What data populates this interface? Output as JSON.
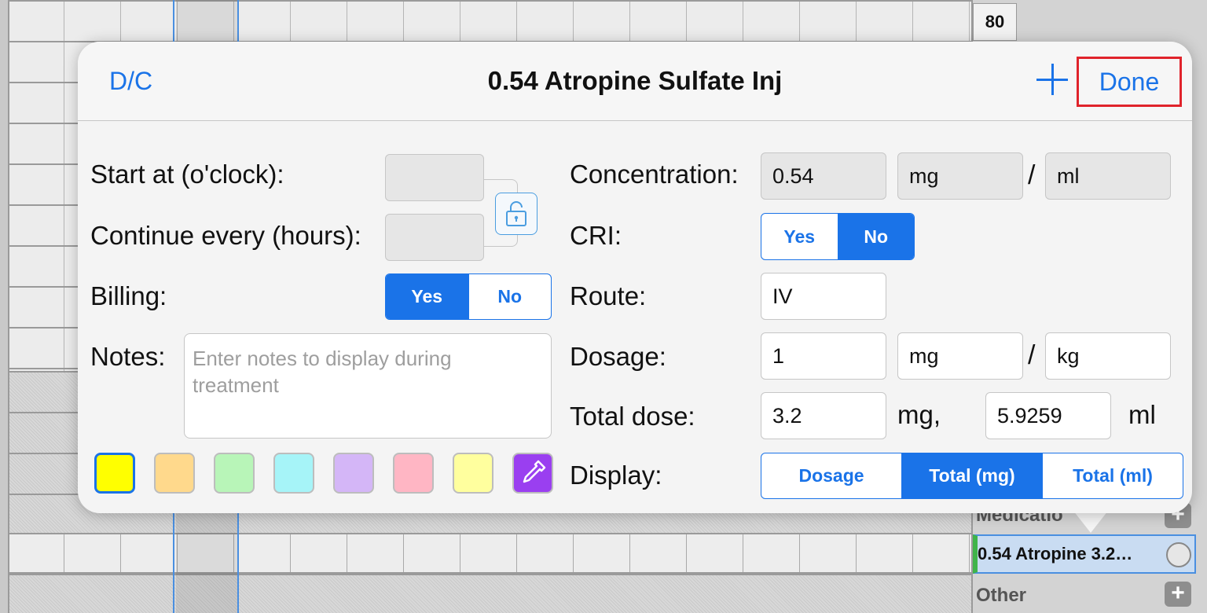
{
  "background": {
    "scale_value": "80",
    "medications_label": "Medicatio",
    "medication_entry": "0.54 Atropine 3.2…",
    "other_label": "Other",
    "add_glyph": "+"
  },
  "dialog": {
    "dc_label": "D/C",
    "title": "0.54 Atropine Sulfate Inj",
    "add_glyph": "+",
    "done_label": "Done"
  },
  "form": {
    "start_at_label": "Start at (o'clock):",
    "start_at_value": "",
    "continue_every_label": "Continue every (hours):",
    "continue_every_value": "",
    "billing_label": "Billing:",
    "billing_options": [
      "Yes",
      "No"
    ],
    "billing_selected": "Yes",
    "notes_label": "Notes:",
    "notes_value": "",
    "notes_placeholder": "Enter notes to display during treatment",
    "colors": [
      "#ffff00",
      "#ffd98c",
      "#b8f5b8",
      "#a6f4f8",
      "#d4b6f7",
      "#ffb6c4",
      "#ffff9e"
    ],
    "selected_color": "#ffff00",
    "color_picker_color": "#9a3ff0",
    "concentration_label": "Concentration:",
    "concentration_value": "0.54",
    "concentration_unit": "mg",
    "concentration_per_unit": "ml",
    "per_separator": "/",
    "cri_label": "CRI:",
    "cri_options": [
      "Yes",
      "No"
    ],
    "cri_selected": "No",
    "route_label": "Route:",
    "route_value": "IV",
    "dosage_label": "Dosage:",
    "dosage_value": "1",
    "dosage_unit": "mg",
    "dosage_per_unit": "kg",
    "total_dose_label": "Total dose:",
    "total_dose_mg": "3.2",
    "total_dose_mg_unit": "mg,",
    "total_dose_ml": "5.9259",
    "total_dose_ml_unit": "ml",
    "display_label": "Display:",
    "display_options": [
      "Dosage",
      "Total (mg)",
      "Total (ml)"
    ],
    "display_selected": "Total (mg)"
  },
  "colors": {
    "accent": "#1a73e8",
    "highlight_border": "#e0232b"
  },
  "icons": {
    "lock": "unlocked-padlock-icon",
    "plus": "plus-icon",
    "picker": "eyedropper-icon"
  }
}
